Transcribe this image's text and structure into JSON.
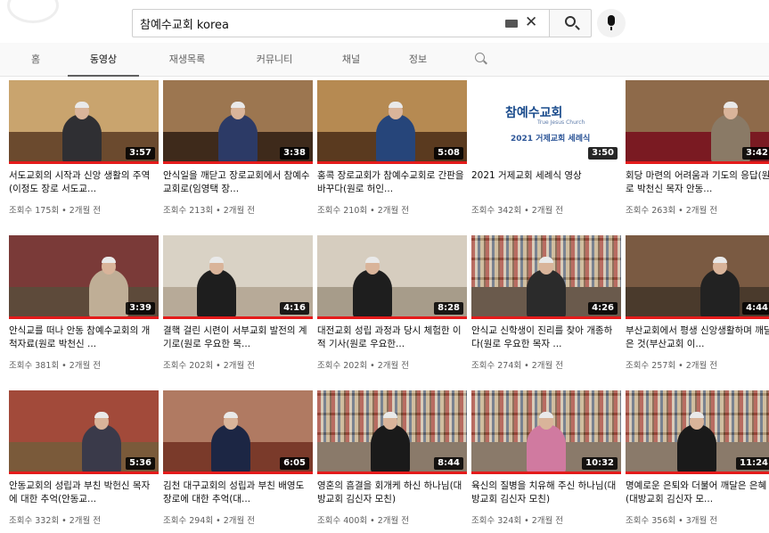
{
  "search": {
    "query": "참예수교회 korea",
    "clear_label": "✕"
  },
  "tabs": [
    {
      "label": "홈"
    },
    {
      "label": "동영상"
    },
    {
      "label": "재생목록"
    },
    {
      "label": "커뮤니티"
    },
    {
      "label": "채널"
    },
    {
      "label": "정보"
    }
  ],
  "thumbnail_logo": {
    "name": "참예수교회",
    "name_en": "True Jesus Church",
    "caption": "2021 거제교회 세례식"
  },
  "videos": [
    {
      "title": "서도교회의 시작과 신앙 생활의 주역(이정도 장로 서도교...",
      "meta": "조회수 175회 • 2개월 전",
      "duration": "3:57",
      "progress": 1.0
    },
    {
      "title": "안식일을 깨닫고 장로교회에서 참예수교회로(임영택 장...",
      "meta": "조회수 213회 • 2개월 전",
      "duration": "3:38",
      "progress": 1.0
    },
    {
      "title": "홍콕 장로교회가 참예수교회로 간판을 바꾸다(원로 허인...",
      "meta": "조회수 210회 • 2개월 전",
      "duration": "5:08",
      "progress": 1.0
    },
    {
      "title": "2021 거제교회 세례식 영상",
      "meta": "조회수 342회 • 2개월 전",
      "duration": "3:50",
      "progress": 0.0
    },
    {
      "title": "회당 마련의 어려움과 기도의 응답(원로 박천신 목자 안동...",
      "meta": "조회수 263회 • 2개월 전",
      "duration": "3:42",
      "progress": 1.0
    },
    {
      "title": "안식교를 떠나 안동 참예수교회의 개척자료(원로 박천신 ...",
      "meta": "조회수 381회 • 2개월 전",
      "duration": "3:39",
      "progress": 1.0
    },
    {
      "title": "결핵 걸린 시련이 서부교회 발전의 계기로(원로 우요한 목...",
      "meta": "조회수 202회 • 2개월 전",
      "duration": "4:16",
      "progress": 1.0
    },
    {
      "title": "대전교회 성립 과정과 당시 체험한 이적 기사(원로 우요한...",
      "meta": "조회수 202회 • 2개월 전",
      "duration": "8:28",
      "progress": 1.0
    },
    {
      "title": "안식교 신학생이 진리를 찾아 개종하다(원로 우요한 목자 ...",
      "meta": "조회수 274회 • 2개월 전",
      "duration": "4:26",
      "progress": 1.0
    },
    {
      "title": "부산교회에서 평생 신앙생활하며 깨달은 것(부산교회 이...",
      "meta": "조회수 257회 • 2개월 전",
      "duration": "4:44",
      "progress": 1.0
    },
    {
      "title": "안동교회의 성립과 부친 박헌신 목자에 대한 추억(안동교...",
      "meta": "조회수 332회 • 2개월 전",
      "duration": "5:36",
      "progress": 1.0
    },
    {
      "title": "김천 대구교회의 성립과 부친 배영도 장로에 대한 추억(대...",
      "meta": "조회수 294회 • 2개월 전",
      "duration": "6:05",
      "progress": 1.0
    },
    {
      "title": "영혼의 흠결을 회개케 하신 하나님(대방교회 김신자 모친)",
      "meta": "조회수 400회 • 2개월 전",
      "duration": "8:44",
      "progress": 1.0
    },
    {
      "title": "육신의 질병을 치유해 주신 하나님(대방교회 김신자 모친)",
      "meta": "조회수 324회 • 2개월 전",
      "duration": "10:32",
      "progress": 1.0
    },
    {
      "title": "명예로운 은퇴와 더불어 깨달은 은혜(대방교회 김신자 모...",
      "meta": "조회수 356회 • 3개월 전",
      "duration": "11:24",
      "progress": 1.0
    }
  ],
  "colors": {
    "progress": "#e41b1b",
    "tab_background": "#f9f9f9"
  }
}
